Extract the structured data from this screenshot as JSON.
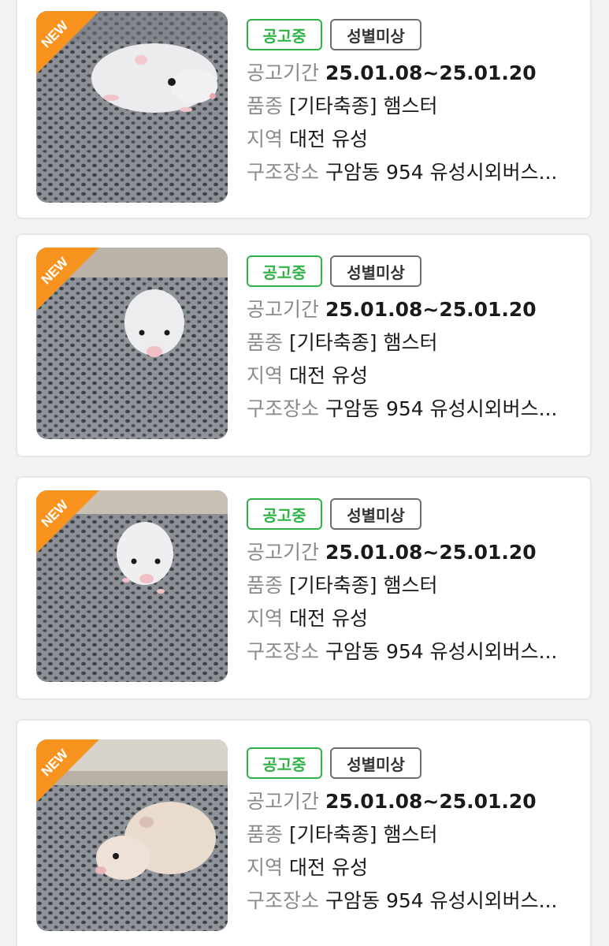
{
  "listings": [
    {
      "new_label": "NEW",
      "status": "공고중",
      "gender": "성별미상",
      "period_label": "공고기간",
      "period": "25.01.08~25.01.20",
      "breed_label": "품종",
      "breed": "[기타축종] 햄스터",
      "region_label": "지역",
      "region": "대전 유성",
      "place_label": "구조장소",
      "place": "구암동 954 유성시외버스..."
    },
    {
      "new_label": "NEW",
      "status": "공고중",
      "gender": "성별미상",
      "period_label": "공고기간",
      "period": "25.01.08~25.01.20",
      "breed_label": "품종",
      "breed": "[기타축종] 햄스터",
      "region_label": "지역",
      "region": "대전 유성",
      "place_label": "구조장소",
      "place": "구암동 954 유성시외버스..."
    },
    {
      "new_label": "NEW",
      "status": "공고중",
      "gender": "성별미상",
      "period_label": "공고기간",
      "period": "25.01.08~25.01.20",
      "breed_label": "품종",
      "breed": "[기타축종] 햄스터",
      "region_label": "지역",
      "region": "대전 유성",
      "place_label": "구조장소",
      "place": "구암동 954 유성시외버스..."
    },
    {
      "new_label": "NEW",
      "status": "공고중",
      "gender": "성별미상",
      "period_label": "공고기간",
      "period": "25.01.08~25.01.20",
      "breed_label": "품종",
      "breed": "[기타축종] 햄스터",
      "region_label": "지역",
      "region": "대전 유성",
      "place_label": "구조장소",
      "place": "구암동 954 유성시외버스..."
    }
  ],
  "colors": {
    "status_green": "#2fb344",
    "new_ribbon": "#f7931e",
    "gender_border": "#6e6e6e"
  },
  "icons": {
    "photo": "hamster-photo"
  }
}
